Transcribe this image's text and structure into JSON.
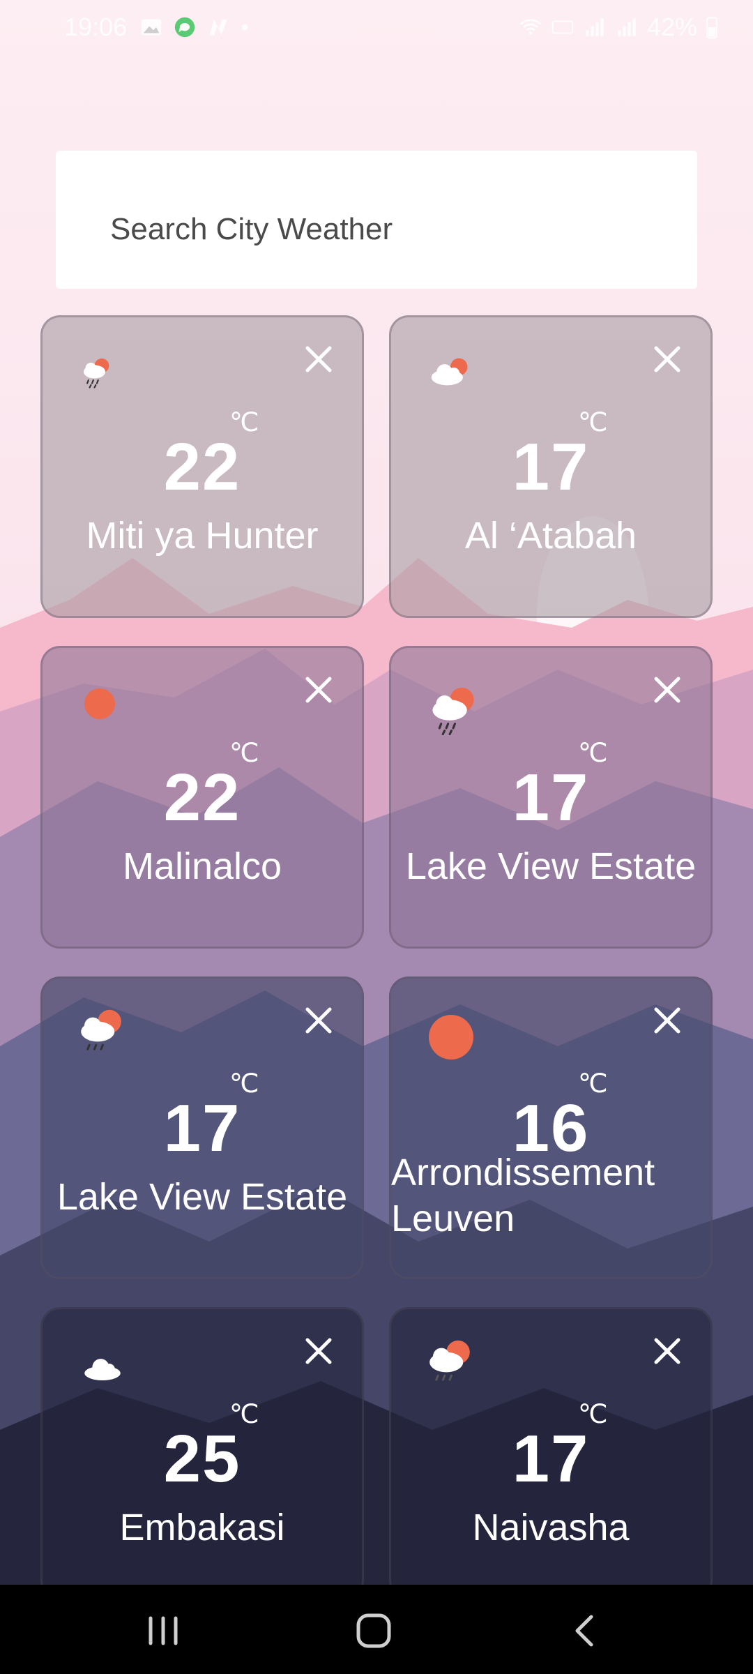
{
  "status_bar": {
    "time": "19:06",
    "battery": "42%"
  },
  "search": {
    "placeholder": "Search City Weather"
  },
  "unit_label": "℃",
  "cards": [
    {
      "temp": "22",
      "city": "Miti ya Hunter",
      "icon": "rain-sun-icon"
    },
    {
      "temp": "17",
      "city": "Al ‘Atabah",
      "icon": "cloud-sun-icon"
    },
    {
      "temp": "22",
      "city": "Malinalco",
      "icon": "sun-icon"
    },
    {
      "temp": "17",
      "city": "Lake View Estate",
      "icon": "rain-sun-icon"
    },
    {
      "temp": "17",
      "city": "Lake View Estate",
      "icon": "rain-sun-icon"
    },
    {
      "temp": "16",
      "city": "Arrondissement Leuven",
      "icon": "sun-icon"
    },
    {
      "temp": "25",
      "city": "Embakasi",
      "icon": "cloud-icon"
    },
    {
      "temp": "17",
      "city": "Naivasha",
      "icon": "rain-sun-icon"
    }
  ],
  "colors": {
    "sun": "#ee6a4c",
    "cloud": "#ffffff",
    "nav_bar": "#000000",
    "search_text": "#4a4a4a"
  }
}
